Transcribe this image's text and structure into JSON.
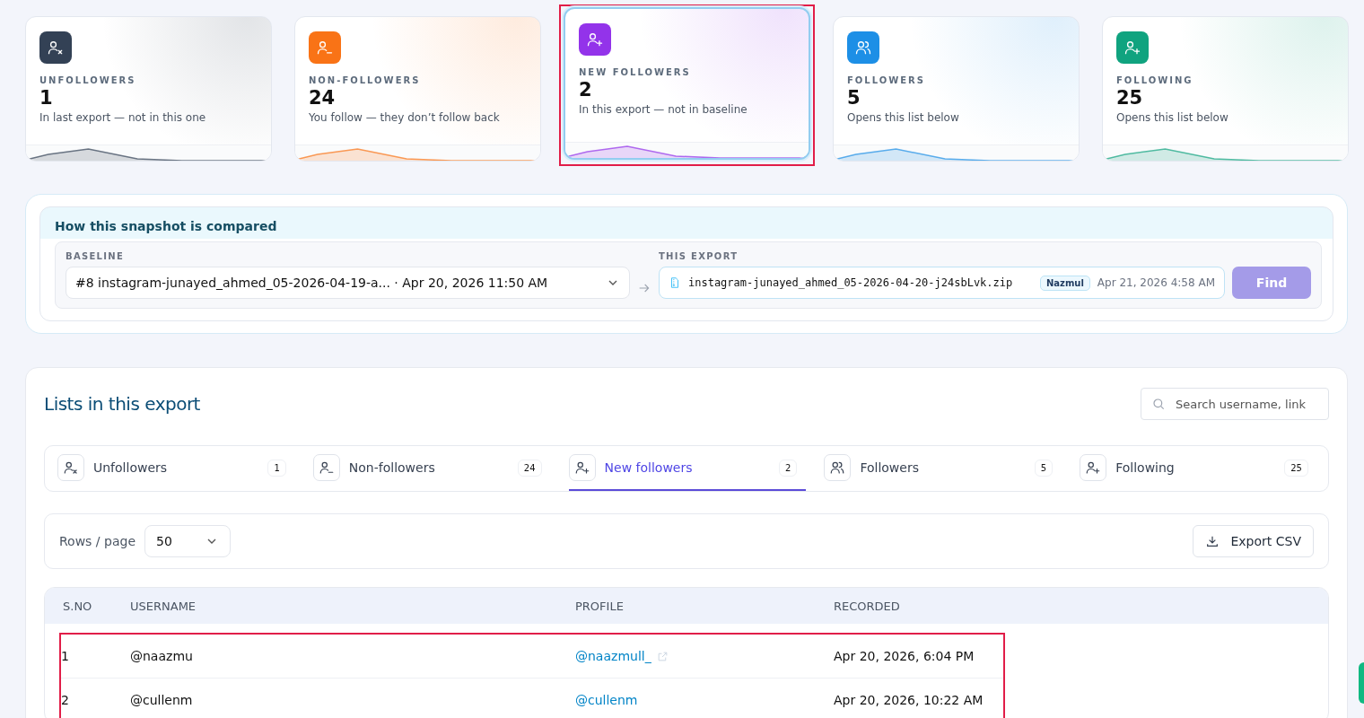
{
  "stat_cards": [
    {
      "kind": "user-x",
      "label": "UNFOLLOWERS",
      "count": "1",
      "description": "In last export — not in this one",
      "color": "#334155",
      "selected": false,
      "highlighted": false
    },
    {
      "kind": "user-minus",
      "label": "NON-FOLLOWERS",
      "count": "24",
      "description": "You follow — they don’t follow back",
      "color": "#f97316",
      "selected": false,
      "highlighted": false
    },
    {
      "kind": "user-plus",
      "label": "NEW FOLLOWERS",
      "count": "2",
      "description": "In this export — not in baseline",
      "color": "#9333ea",
      "selected": true,
      "highlighted": true
    },
    {
      "kind": "users",
      "label": "FOLLOWERS",
      "count": "5",
      "description": "Opens this list below",
      "color": "#1d8fe6",
      "selected": false,
      "highlighted": false
    },
    {
      "kind": "user-plus",
      "label": "FOLLOWING",
      "count": "25",
      "description": "Opens this list below",
      "color": "#10a37f",
      "selected": false,
      "highlighted": false
    }
  ],
  "comparison": {
    "title": "How this snapshot is compared",
    "baseline": {
      "label": "BASELINE",
      "value": "#8 instagram-junayed_ahmed_05-2026-04-19-a... · Apr 20, 2026 11:50 AM"
    },
    "this_export": {
      "label": "THIS EXPORT",
      "file": "instagram-junayed_ahmed_05-2026-04-20-j24sbLvk.zip",
      "tag": "Nazmul",
      "date": "Apr 21, 2026 4:58 AM"
    },
    "button": "Find"
  },
  "lists": {
    "title": "Lists in this export",
    "search": {
      "placeholder": "Search username, link"
    },
    "tabs": [
      {
        "kind": "user-x",
        "label": "Unfollowers",
        "count": "1",
        "selected": false
      },
      {
        "kind": "user-minus",
        "label": "Non-followers",
        "count": "24",
        "selected": false
      },
      {
        "kind": "user-plus",
        "label": "New followers",
        "count": "2",
        "selected": true
      },
      {
        "kind": "users",
        "label": "Followers",
        "count": "5",
        "selected": false
      },
      {
        "kind": "user-plus",
        "label": "Following",
        "count": "25",
        "selected": false
      }
    ],
    "rows_per_page": {
      "label": "Rows / page",
      "value": "50"
    },
    "export_button": "Export CSV",
    "table": {
      "columns": [
        "S.NO",
        "USERNAME",
        "PROFILE",
        "RECORDED"
      ],
      "highlighted": true,
      "rows": [
        {
          "sno": "1",
          "username": "@naazmu",
          "profile": "@naazmull_",
          "link_icon": true,
          "recorded": "Apr 20, 2026, 6:04 PM"
        },
        {
          "sno": "2",
          "username": "@cullenm",
          "profile": "@cullenm",
          "link_icon": false,
          "recorded": "Apr 20, 2026, 10:22 AM"
        }
      ]
    }
  }
}
